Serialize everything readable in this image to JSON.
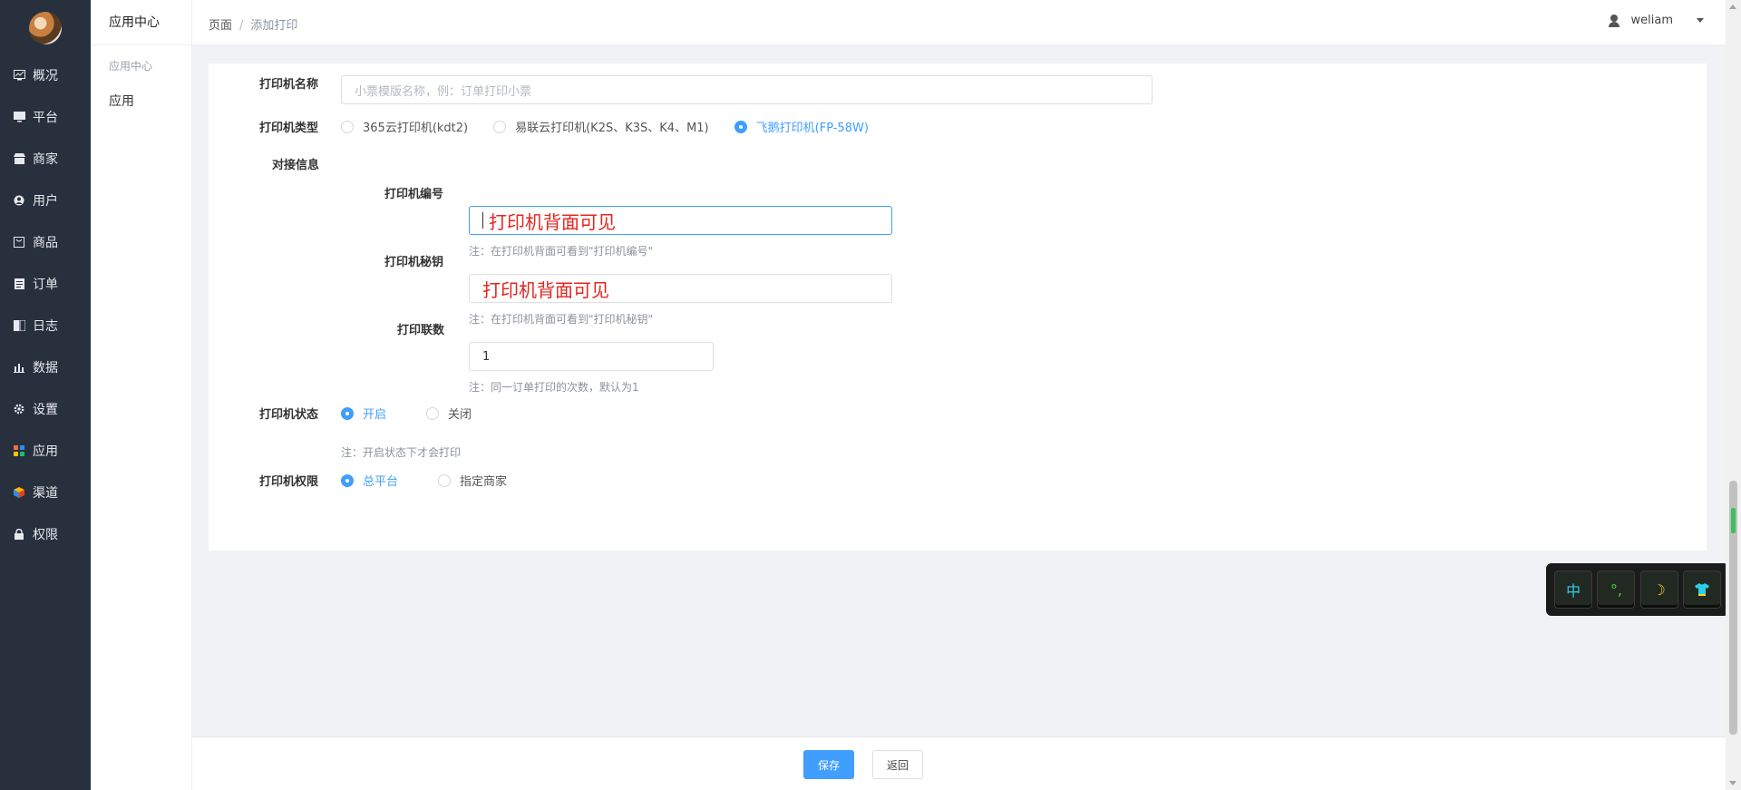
{
  "sidebar": {
    "items": [
      {
        "label": "概况",
        "icon": "monitor-chart-icon"
      },
      {
        "label": "平台",
        "icon": "desktop-icon"
      },
      {
        "label": "商家",
        "icon": "store-icon"
      },
      {
        "label": "用户",
        "icon": "user-icon"
      },
      {
        "label": "商品",
        "icon": "product-icon"
      },
      {
        "label": "订单",
        "icon": "order-icon"
      },
      {
        "label": "日志",
        "icon": "log-icon"
      },
      {
        "label": "数据",
        "icon": "bar-chart-icon"
      },
      {
        "label": "设置",
        "icon": "gear-icon"
      },
      {
        "label": "应用",
        "icon": "apps-grid-icon"
      },
      {
        "label": "渠道",
        "icon": "cube-icon"
      },
      {
        "label": "权限",
        "icon": "lock-icon"
      }
    ]
  },
  "subsidebar": {
    "title": "应用中心",
    "group": "应用中心",
    "link": "应用"
  },
  "header": {
    "breadcrumb_root": "页面",
    "breadcrumb_sep": "/",
    "breadcrumb_current": "添加打印",
    "username": "weliam"
  },
  "form": {
    "name_label": "打印机名称",
    "name_placeholder": "小票模版名称，例：订单打印小票",
    "type_label": "打印机类型",
    "type_options": [
      "365云打印机(kdt2)",
      "易联云打印机(K2S、K3S、K4、M1)",
      "飞鹅打印机(FP-58W)"
    ],
    "type_selected": 2,
    "section_title": "对接信息",
    "code_label": "打印机编号",
    "code_value": "打印机背面可见",
    "code_note": "注：在打印机背面可看到\"打印机编号\"",
    "key_label": "打印机秘钥",
    "key_value": "打印机背面可见",
    "key_note": "注：在打印机背面可看到\"打印机秘钥\"",
    "copies_label": "打印联数",
    "copies_value": "1",
    "copies_note": "注：同一订单打印的次数，默认为1",
    "status_label": "打印机状态",
    "status_options": [
      "开启",
      "关闭"
    ],
    "status_selected": 0,
    "status_note": "注：开启状态下才会打印",
    "perm_label": "打印机权限",
    "perm_options": [
      "总平台",
      "指定商家"
    ],
    "perm_selected": 0
  },
  "footer": {
    "save_label": "保存",
    "back_label": "返回"
  },
  "widget": {
    "buttons": [
      {
        "glyph": "中",
        "color": "#2bd0e8",
        "icon": "chinese-input-icon"
      },
      {
        "glyph": "°,",
        "color": "#4bd13a",
        "icon": "punctuation-icon"
      },
      {
        "glyph": "☽",
        "color": "#f2d21f",
        "icon": "moon-icon"
      },
      {
        "glyph": "👕",
        "color": "#2bd0e8",
        "icon": "skin-icon"
      }
    ]
  }
}
